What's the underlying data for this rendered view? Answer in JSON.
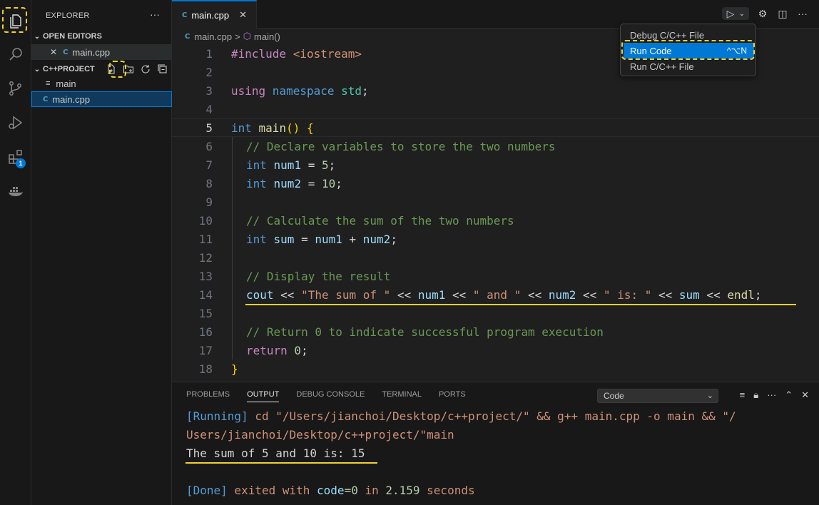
{
  "explorer": {
    "title": "EXPLORER",
    "more": "···",
    "open_editors_label": "OPEN EDITORS",
    "open_editor_file": "main.cpp",
    "project_label": "C++PROJECT",
    "files": [
      "main",
      "main.cpp"
    ],
    "cpp_icon": "C"
  },
  "activity": {
    "extensions_badge": "1"
  },
  "tab": {
    "label": "main.cpp",
    "close": "✕"
  },
  "breadcrumb": {
    "file": "main.cpp",
    "sep": ">",
    "symbol": "main()"
  },
  "editor": {
    "lines": [
      {
        "n": "1"
      },
      {
        "n": "2"
      },
      {
        "n": "3"
      },
      {
        "n": "4"
      },
      {
        "n": "5"
      },
      {
        "n": "6"
      },
      {
        "n": "7"
      },
      {
        "n": "8"
      },
      {
        "n": "9"
      },
      {
        "n": "10"
      },
      {
        "n": "11"
      },
      {
        "n": "12"
      },
      {
        "n": "13"
      },
      {
        "n": "14"
      },
      {
        "n": "15"
      },
      {
        "n": "16"
      },
      {
        "n": "17"
      },
      {
        "n": "18"
      }
    ],
    "code": {
      "l1_kw": "#include",
      "l1_hdr": " <iostream>",
      "l3_using": "using",
      "l3_ns": " namespace",
      "l3_std": " std",
      "l3_semi": ";",
      "l5_int": "int",
      "l5_main": " main",
      "l5_paren": "()",
      "l5_brace": " {",
      "l6_cm": "// Declare variables to store the two numbers",
      "l7_int": "int",
      "l7_var": " num1",
      "l7_eq": " = ",
      "l7_num": "5",
      "l7_semi": ";",
      "l8_int": "int",
      "l8_var": " num2",
      "l8_eq": " = ",
      "l8_num": "10",
      "l8_semi": ";",
      "l10_cm": "// Calculate the sum of the two numbers",
      "l11_int": "int",
      "l11_sum": " sum",
      "l11_eq": " = ",
      "l11_n1": "num1",
      "l11_plus": " + ",
      "l11_n2": "num2",
      "l11_semi": ";",
      "l13_cm": "// Display the result",
      "l14_cout": "cout",
      "l14_op1": " << ",
      "l14_s1": "\"The sum of \"",
      "l14_op2": " << ",
      "l14_n1": "num1",
      "l14_op3": " << ",
      "l14_s2": "\" and \"",
      "l14_op4": " << ",
      "l14_n2": "num2",
      "l14_op5": " << ",
      "l14_s3": "\" is: \"",
      "l14_op6": " << ",
      "l14_sum": "sum",
      "l14_op7": " << ",
      "l14_endl": "endl",
      "l14_semi": ";",
      "l16_cm": "// Return 0 to indicate successful program execution",
      "l17_ret": "return",
      "l17_num": " 0",
      "l17_semi": ";",
      "l18_brace": "}"
    }
  },
  "menu": {
    "items": [
      {
        "label": "Debug C/C++ File"
      },
      {
        "label": "Run Code",
        "shortcut": "^⌥N"
      },
      {
        "label": "Run C/C++ File"
      }
    ]
  },
  "panel": {
    "tabs": [
      "PROBLEMS",
      "OUTPUT",
      "DEBUG CONSOLE",
      "TERMINAL",
      "PORTS"
    ],
    "active_tab": "OUTPUT",
    "channel": "Code",
    "output": {
      "running_tag": "[Running]",
      "cmd1": " cd \"/Users/jianchoi/Desktop/c++project/\" && g++ main.cpp -o main && \"/",
      "cmd2": "Users/jianchoi/Desktop/c++project/\"main",
      "result": "The sum of 5 and 10 is: 15",
      "done_tag": "[Done]",
      "exited": " exited with ",
      "code_kw": "code",
      "code_val": "=0",
      "in": " in ",
      "secs": "2.159",
      "seconds": " seconds"
    }
  }
}
